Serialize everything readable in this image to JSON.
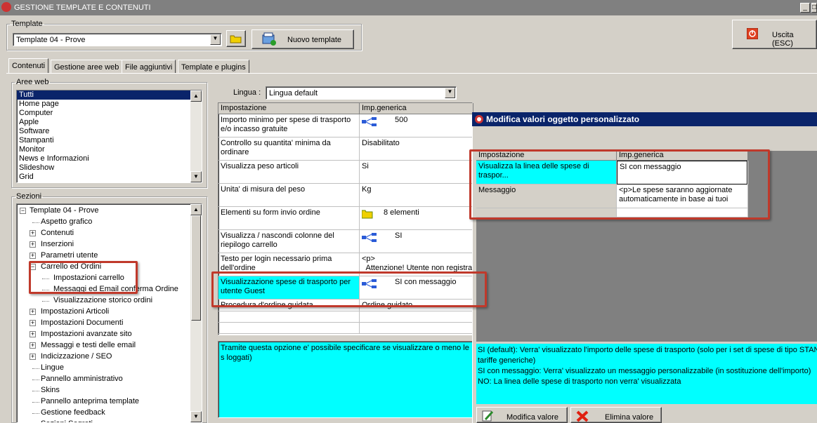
{
  "window": {
    "title": "GESTIONE TEMPLATE E CONTENUTI",
    "minimize": "_",
    "maximize": "□"
  },
  "template_group": {
    "legend": "Template",
    "selected": "Template 04 - Prove",
    "new_button": "Nuovo template"
  },
  "exit_button": "Uscita (ESC)",
  "tabs": [
    "Contenuti",
    "Gestione aree web",
    "File aggiuntivi",
    "Template e plugins"
  ],
  "aree_web": {
    "legend": "Aree web",
    "items": [
      "Tutti",
      "Home page",
      "Computer",
      "Apple",
      "Software",
      "Stampanti",
      "Monitor",
      "News e Informazioni",
      "Slideshow",
      "Grid"
    ],
    "selected_index": 0
  },
  "sezioni": {
    "legend": "Sezioni",
    "root": "Template 04 - Prove",
    "items": [
      {
        "label": "Aspetto grafico",
        "expander": ""
      },
      {
        "label": "Contenuti",
        "expander": "+"
      },
      {
        "label": "Inserzioni",
        "expander": "+"
      },
      {
        "label": "Parametri utente",
        "expander": "+"
      },
      {
        "label": "Carrello ed Ordini",
        "expander": "-"
      },
      {
        "label": "Impostazioni carrello",
        "expander": "",
        "child": true
      },
      {
        "label": "Messaggi ed Email conferma Ordine",
        "expander": "",
        "child": true
      },
      {
        "label": "Visualizzazione storico ordini",
        "expander": "",
        "child": true
      },
      {
        "label": "Impostazioni Articoli",
        "expander": "+"
      },
      {
        "label": "Impostazioni Documenti",
        "expander": "+"
      },
      {
        "label": "Impostazioni avanzate sito",
        "expander": "+"
      },
      {
        "label": "Messaggi e testi delle email",
        "expander": "+"
      },
      {
        "label": "Indicizzazione / SEO",
        "expander": "+"
      },
      {
        "label": "Lingue",
        "expander": ""
      },
      {
        "label": "Pannello amministrativo",
        "expander": ""
      },
      {
        "label": "Skins",
        "expander": ""
      },
      {
        "label": "Pannello anteprima template",
        "expander": ""
      },
      {
        "label": "Gestione feedback",
        "expander": ""
      },
      {
        "label": "Sezioni Segreti",
        "expander": ""
      }
    ]
  },
  "lingua": {
    "label": "Lingua :",
    "selected": "Lingua default"
  },
  "main_grid": {
    "headers": [
      "Impostazione",
      "Imp.generica"
    ],
    "rows": [
      {
        "name": "Importo minimo per spese di trasporto e/o incasso gratuite",
        "value": "500",
        "icon": "tree-icon"
      },
      {
        "name": "Controllo su quantita' minima da ordinare",
        "value": "Disabilitato",
        "icon": ""
      },
      {
        "name": "Visualizza peso articoli",
        "value": "Si",
        "icon": ""
      },
      {
        "name": "Unita' di misura del peso",
        "value": "Kg",
        "icon": ""
      },
      {
        "name": "Elementi su form invio ordine",
        "value": "8 elementi",
        "icon": "folder-icon"
      },
      {
        "name": "Visualizza / nascondi colonne del riepilogo carrello",
        "value": "SI",
        "icon": "tree-icon"
      },
      {
        "name": "Testo per login necessario prima dell'ordine",
        "value": "<p>\n  Attenzione! Utente non registrat",
        "icon": ""
      },
      {
        "name": "Visualizzazione spese di trasporto per utente Guest",
        "value": "SI con messaggio",
        "icon": "tree-icon"
      },
      {
        "name": "Procedura d'ordine guidata",
        "value": "Ordine guidato",
        "icon": ""
      }
    ],
    "description": "Tramite questa opzione e' possibile specificare se visualizzare o meno le s loggati)"
  },
  "dialog": {
    "title": "Modifica valori oggetto personalizzato",
    "headers": [
      "Impostazione",
      "Imp.generica"
    ],
    "rows": [
      {
        "name": "Visualizza la linea delle spese di traspor...",
        "value": "SI con messaggio"
      },
      {
        "name": "Messaggio",
        "value": "<p>Le spese saranno aggiornate automaticamente in base ai tuoi"
      }
    ],
    "help_lines": [
      "SI (default): Verra' visualizzato l'importo delle spese di trasporto (solo per i set di spese di tipo STAND",
      "tariffe generiche)",
      "SI con messaggio: Verra' visualizzato un messaggio personalizzabile (in sostituzione dell'importo)",
      "NO: La linea delle spese di trasporto non verra' visualizzata"
    ],
    "modify_button": "Modifica valore",
    "delete_button": "Elimina valore"
  },
  "colors": {
    "highlight": "#00ffff",
    "selection": "#0a246a",
    "annotation": "#c0392b",
    "face": "#d4d0c8"
  }
}
